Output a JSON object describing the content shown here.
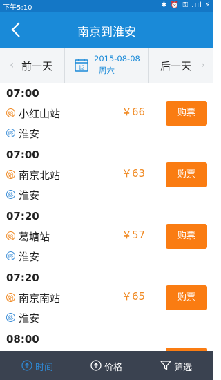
{
  "status_bar": {
    "time": "下午5:10",
    "icons": "✱ ⏰ ⚿ .ııl ⚡"
  },
  "header": {
    "title": "南京到淮安"
  },
  "date_nav": {
    "prev_label": "前一天",
    "date": "2015-08-08",
    "weekday": "周六",
    "next_label": "后一天",
    "calendar_day": "12"
  },
  "badges": {
    "start": "始",
    "end": "终"
  },
  "trips": [
    {
      "time": "07:00",
      "origin": "小红山站",
      "destination": "淮安",
      "price": "￥66",
      "buy_label": "购票"
    },
    {
      "time": "07:00",
      "origin": "南京北站",
      "destination": "淮安",
      "price": "￥63",
      "buy_label": "购票"
    },
    {
      "time": "07:20",
      "origin": "葛塘站",
      "destination": "淮安",
      "price": "￥57",
      "buy_label": "购票"
    },
    {
      "time": "07:20",
      "origin": "南京南站",
      "destination": "淮安",
      "price": "￥65",
      "buy_label": "购票"
    },
    {
      "time": "08:00",
      "origin": "",
      "destination": "",
      "price": "",
      "buy_label": ""
    }
  ],
  "bottom_tabs": {
    "time": "时间",
    "price": "价格",
    "filter": "筛选"
  },
  "colors": {
    "accent": "#1a8ad8",
    "buy": "#fa7c12",
    "price": "#f08a24",
    "tabbar": "#3a4250"
  }
}
